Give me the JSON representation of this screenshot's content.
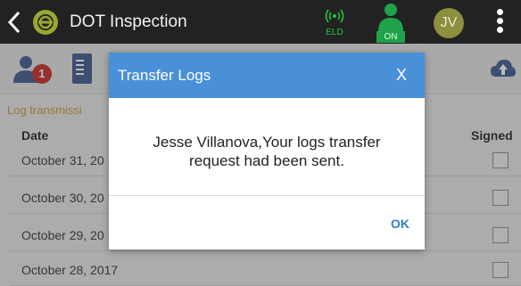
{
  "header": {
    "title": "DOT Inspection",
    "eld_label": "ELD",
    "status_label": "ON",
    "avatar_initials": "JV",
    "colors": {
      "bar": "#222222",
      "eld_green": "#25c73b",
      "on_green": "#1fa34a",
      "avatar": "#8b8f3e"
    }
  },
  "toolbar": {
    "notification_count": "1",
    "icons": [
      "users-icon",
      "document-list-icon",
      "cloud-upload-icon"
    ]
  },
  "logs": {
    "section_label": "Log transmissi",
    "columns": {
      "date": "Date",
      "signed": "Signed"
    },
    "rows": [
      {
        "date": "October 31, 20",
        "signed": false
      },
      {
        "date": "October 30, 20",
        "signed": false
      },
      {
        "date": "October 29, 20",
        "signed": false
      },
      {
        "date": "October 28, 2017",
        "signed": false
      }
    ]
  },
  "dialog": {
    "title": "Transfer Logs",
    "close_label": "X",
    "message_line1": "Jesse Villanova,Your logs transfer",
    "message_line2": "request had been sent.",
    "ok_label": "OK",
    "colors": {
      "header": "#4a90d9",
      "ok": "#2f7fd3"
    }
  }
}
